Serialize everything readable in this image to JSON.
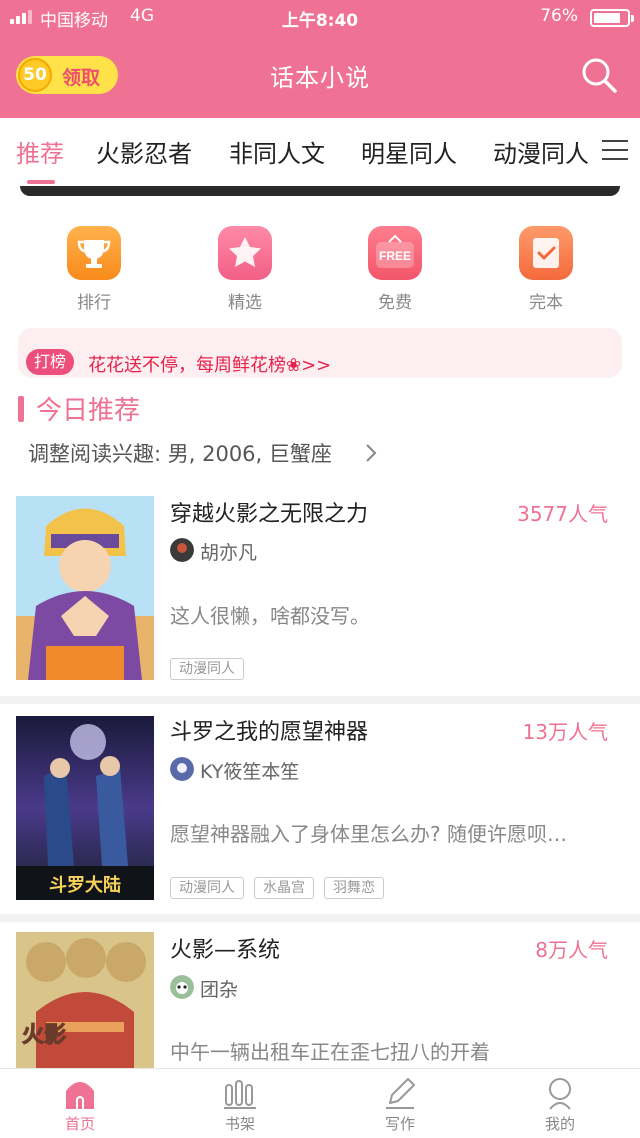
{
  "status_bar": {
    "carrier": "中国移动",
    "network": "4G",
    "time": "上午8:40",
    "battery": "76%"
  },
  "header": {
    "coin_count": "50",
    "coin_label": "领取",
    "title": "话本小说"
  },
  "tabs": [
    "推荐",
    "火影忍者",
    "非同人文",
    "明星同人",
    "动漫同人"
  ],
  "entries": [
    {
      "label": "排行",
      "icon": "trophy-icon"
    },
    {
      "label": "精选",
      "icon": "star-icon"
    },
    {
      "label": "免费",
      "icon": "free-icon",
      "icon_text": "FREE"
    },
    {
      "label": "完本",
      "icon": "check-book-icon"
    }
  ],
  "notice": {
    "badge": "打榜",
    "text": "花花送不停，每周鲜花榜❀>>"
  },
  "section": {
    "title": "今日推荐",
    "prefs": "调整阅读兴趣: 男, 2006, 巨蟹座"
  },
  "books": [
    {
      "title": "穿越火影之无限之力",
      "popularity": "3577人气",
      "author": "胡亦凡",
      "description": "这人很懒，啥都没写。",
      "tags": [
        "动漫同人"
      ]
    },
    {
      "title": "斗罗之我的愿望神器",
      "popularity": "13万人气",
      "author": "KY筱笙本笙",
      "description": "愿望神器融入了身体里怎么办? 随便许愿呗…",
      "tags": [
        "动漫同人",
        "水晶宫",
        "羽舞恋"
      ],
      "cover_text": "斗罗大陆"
    },
    {
      "title": "火影—系统",
      "popularity": "8万人气",
      "author": "团杂",
      "description": "中午一辆出租车正在歪七扭八的开着",
      "tags": [],
      "cover_text": "火影"
    }
  ],
  "bottom_nav": [
    {
      "label": "首页",
      "active": true
    },
    {
      "label": "书架",
      "active": false
    },
    {
      "label": "写作",
      "active": false
    },
    {
      "label": "我的",
      "active": false
    }
  ],
  "colors": {
    "brand": "#ef7193",
    "accent_red": "#e6234a",
    "coin": "#ffe24a"
  }
}
